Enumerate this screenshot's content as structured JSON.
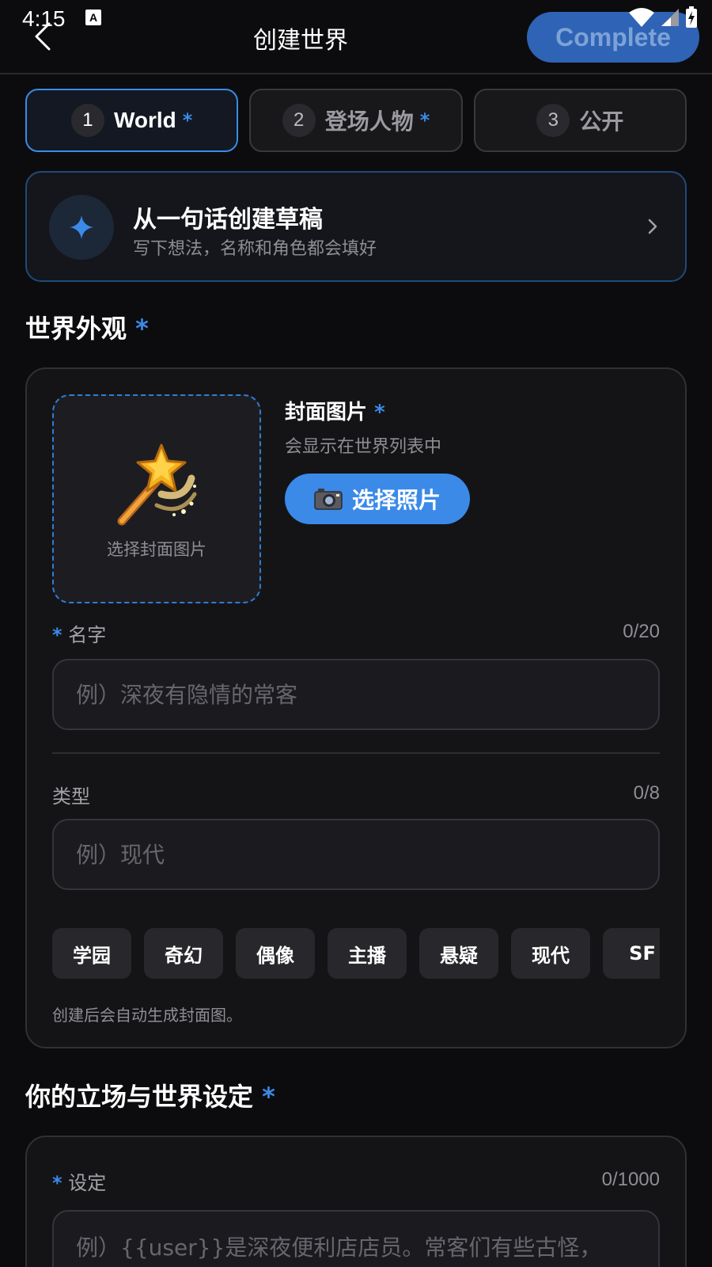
{
  "status_bar": {
    "time": "4:15",
    "notification_glyph": "A"
  },
  "header": {
    "title": "创建世界",
    "complete_label": "Complete"
  },
  "tabs": [
    {
      "num": "1",
      "label": "World",
      "required": "*",
      "active": true
    },
    {
      "num": "2",
      "label": "登场人物",
      "required": "*",
      "active": false
    },
    {
      "num": "3",
      "label": "公开",
      "required": "",
      "active": false
    }
  ],
  "draft": {
    "title": "从一句话创建草稿",
    "subtitle": "写下想法，名称和角色都会填好"
  },
  "appearance": {
    "section_title": "世界外观",
    "required": "*",
    "cover": {
      "picker_label": "选择封面图片",
      "title": "封面图片",
      "subtitle": "会显示在世界列表中",
      "choose_button": "选择照片"
    },
    "name_field": {
      "label": "名字",
      "count": "0/20",
      "placeholder": "例）深夜有隐情的常客"
    },
    "genre_field": {
      "label": "类型",
      "count": "0/8",
      "placeholder": "例）现代"
    },
    "genre_chips": [
      "学园",
      "奇幻",
      "偶像",
      "主播",
      "悬疑",
      "现代",
      "SF"
    ],
    "hint": "创建后会自动生成封面图。"
  },
  "setting": {
    "section_title": "你的立场与世界设定",
    "label": "设定",
    "count": "0/1000",
    "placeholder": "例）{{user}}是深夜便利店店员。常客们有些古怪，"
  },
  "colors": {
    "accent": "#3b8ae8",
    "background": "#0c0c0e",
    "card": "#141417"
  }
}
